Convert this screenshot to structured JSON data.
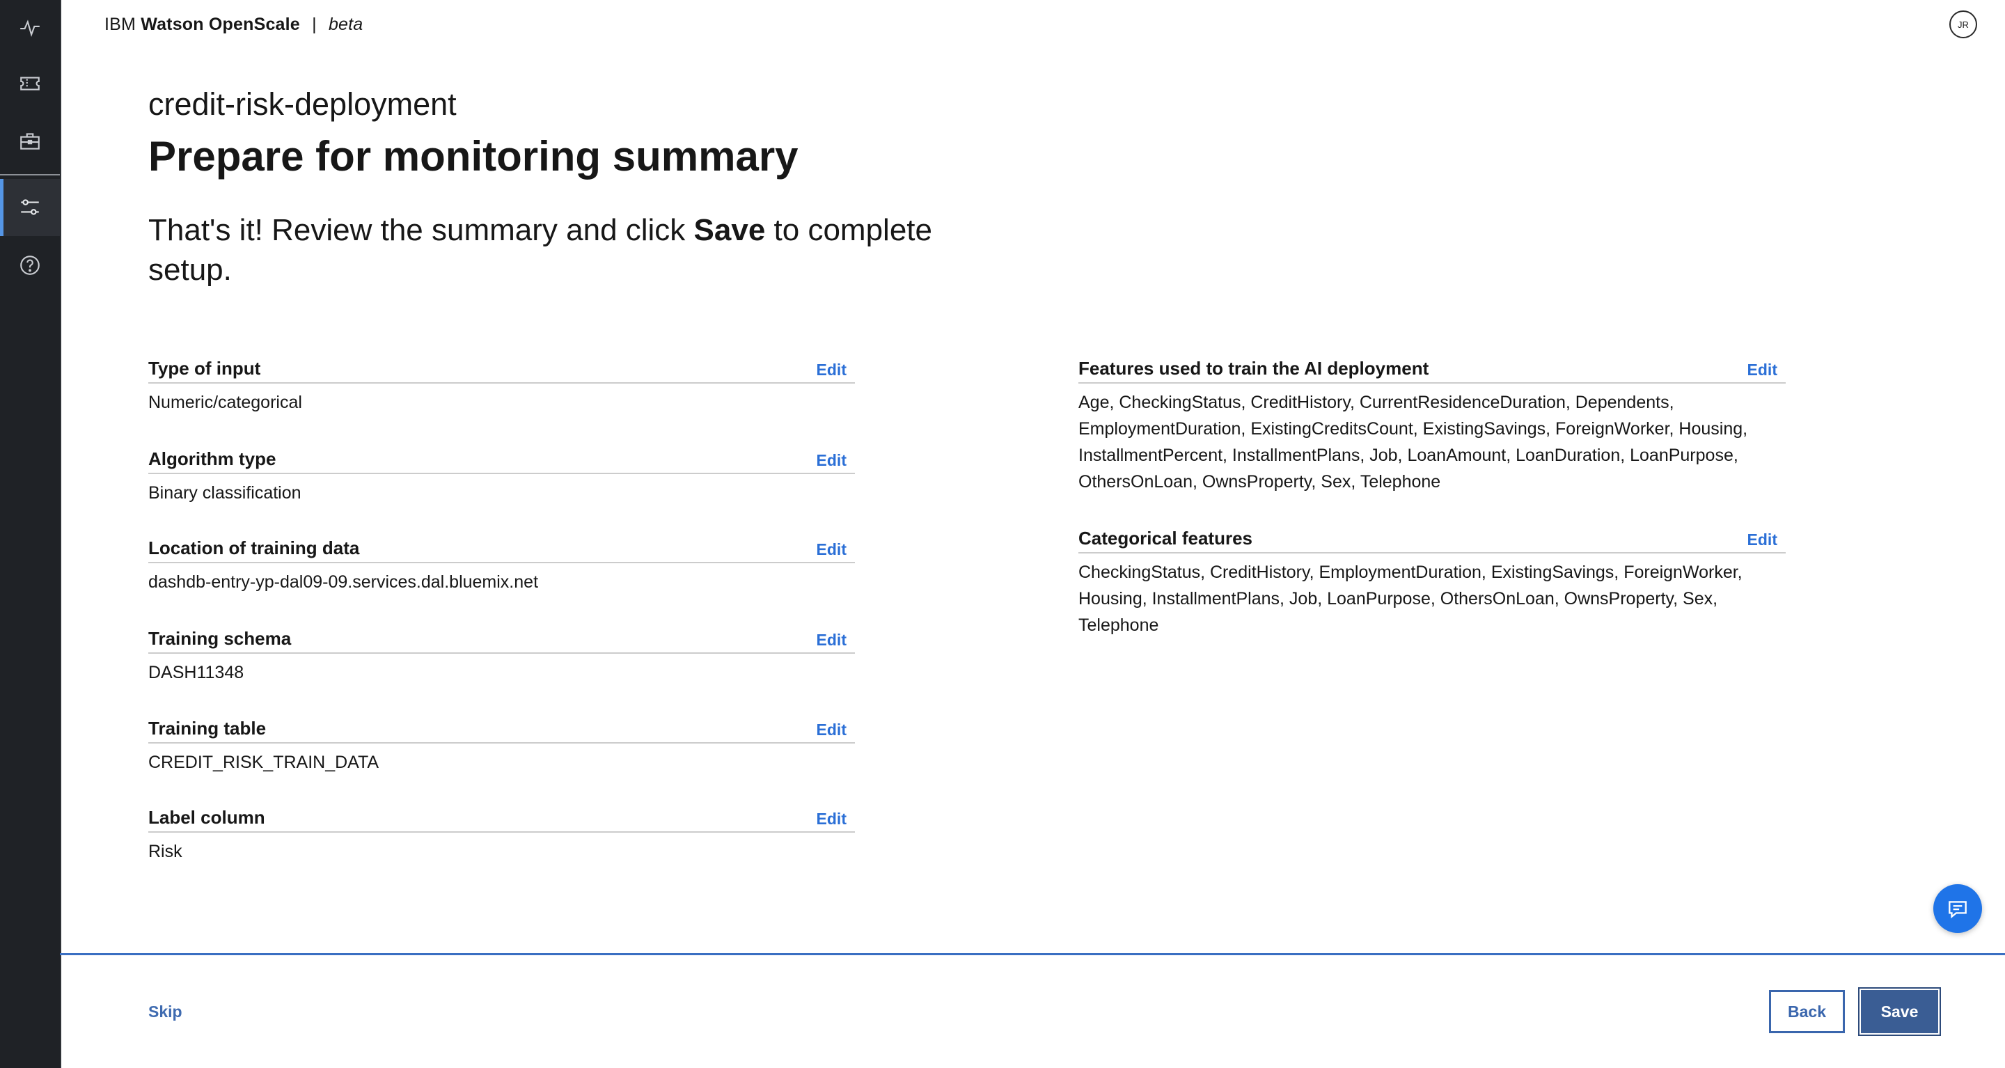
{
  "header": {
    "brand_ibm": "IBM",
    "brand_product": "Watson OpenScale",
    "brand_separator": "|",
    "brand_badge": "beta",
    "avatar_initials": "JR"
  },
  "sidebar": {
    "items": [
      {
        "icon": "activity-icon"
      },
      {
        "icon": "ticket-icon"
      },
      {
        "icon": "briefcase-icon"
      },
      {
        "icon": "settings-sliders-icon",
        "active": true
      },
      {
        "icon": "help-icon"
      }
    ]
  },
  "main": {
    "deployment_name": "credit-risk-deployment",
    "title": "Prepare for monitoring summary",
    "intro_before": "That's it! Review the summary and click ",
    "intro_bold": "Save",
    "intro_after": " to complete setup."
  },
  "sections_left": [
    {
      "label": "Type of input",
      "edit": "Edit",
      "value": "Numeric/categorical"
    },
    {
      "label": "Algorithm type",
      "edit": "Edit",
      "value": "Binary classification"
    },
    {
      "label": "Location of training data",
      "edit": "Edit",
      "value": "dashdb-entry-yp-dal09-09.services.dal.bluemix.net"
    },
    {
      "label": "Training schema",
      "edit": "Edit",
      "value": "DASH11348"
    },
    {
      "label": "Training table",
      "edit": "Edit",
      "value": "CREDIT_RISK_TRAIN_DATA"
    },
    {
      "label": "Label column",
      "edit": "Edit",
      "value": "Risk"
    }
  ],
  "sections_right": [
    {
      "label": "Features used to train the AI deployment",
      "edit": "Edit",
      "value": "Age, CheckingStatus, CreditHistory, CurrentResidenceDuration, Dependents, EmploymentDuration, ExistingCreditsCount, ExistingSavings, ForeignWorker, Housing, InstallmentPercent, InstallmentPlans, Job, LoanAmount, LoanDuration, LoanPurpose, OthersOnLoan, OwnsProperty, Sex, Telephone"
    },
    {
      "label": "Categorical features",
      "edit": "Edit",
      "value": "CheckingStatus, CreditHistory, EmploymentDuration, ExistingSavings, ForeignWorker, Housing, InstallmentPlans, Job, LoanPurpose, OthersOnLoan, OwnsProperty, Sex, Telephone"
    }
  ],
  "footer": {
    "skip_label": "Skip",
    "back_label": "Back",
    "save_label": "Save"
  },
  "colors": {
    "sidebar_bg": "#1f2226",
    "accent": "#2b6fd6",
    "primary_button": "#3a5d94",
    "chat_button": "#1f74e8"
  }
}
